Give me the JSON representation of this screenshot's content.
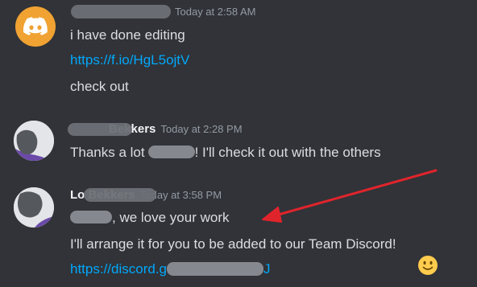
{
  "messages": [
    {
      "timestamp": "Today at 2:58 AM",
      "lines": [
        "i have done editing",
        "https://f.io/HgL5ojtV",
        "check out"
      ]
    },
    {
      "username_visible": "Bekkers",
      "timestamp": "Today at 2:28 PM",
      "lines": [
        "Thanks a lot",
        "! I'll check it out with the others"
      ]
    },
    {
      "username_visible": "Lo Bekkers",
      "timestamp": "Today at 3:58 PM",
      "lines": [
        ", we love your work",
        "I'll arrange it for you to be added to our Team Discord!",
        "https://discord.g",
        "J"
      ]
    }
  ],
  "icons": {
    "avatar_1": "discord-logo-icon",
    "emoji": "slightly-smiling-face-icon",
    "annotation": "red-arrow-icon"
  },
  "colors": {
    "background": "#313338",
    "text": "#dbdee1",
    "link": "#00a8fc",
    "timestamp": "#949ba4",
    "discord_avatar": "#f0a232",
    "arrow": "#e0242c"
  }
}
